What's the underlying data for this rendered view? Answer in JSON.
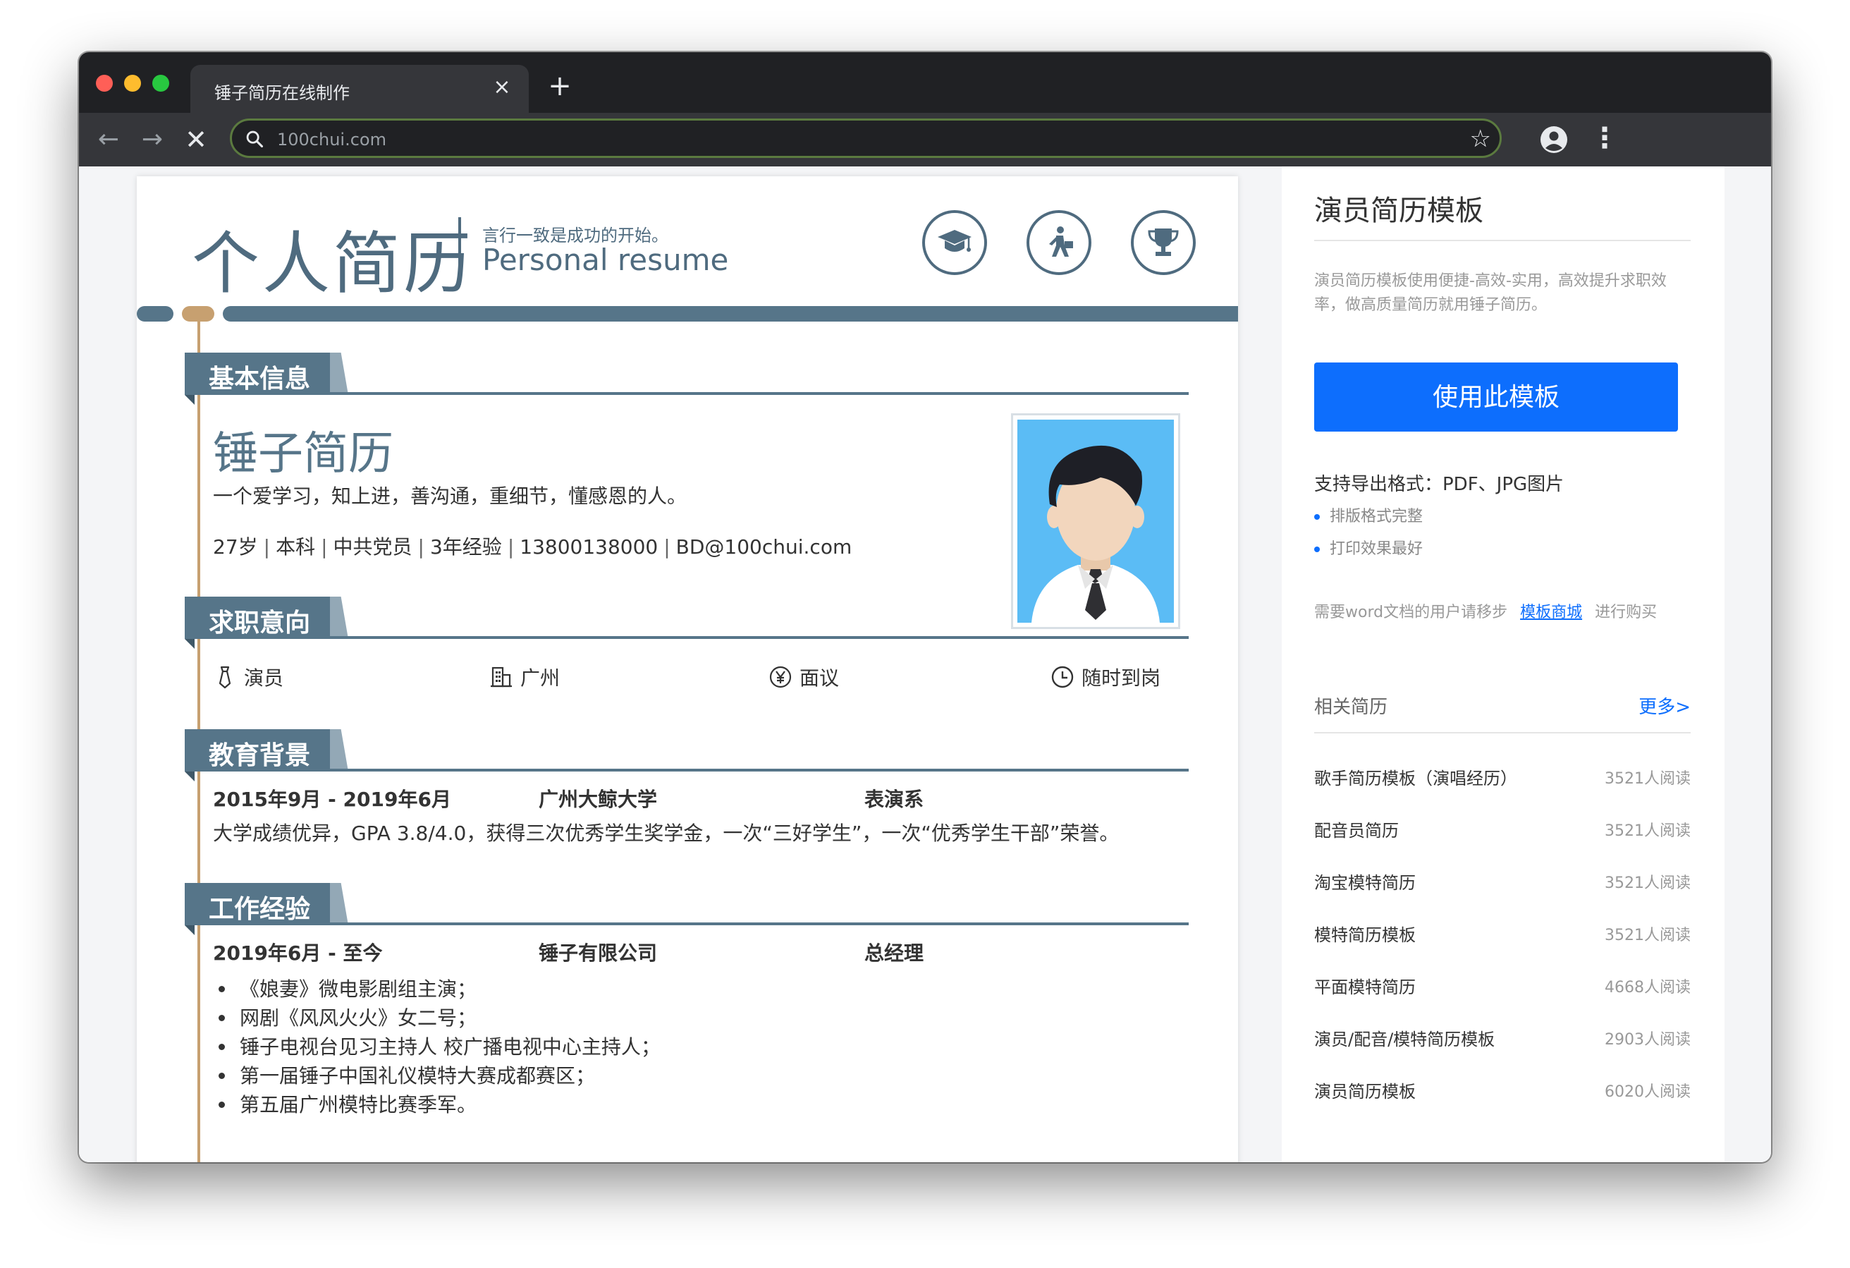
{
  "browser": {
    "tab_title": "锤子简历在线制作",
    "tab_close": "×",
    "new_tab": "+",
    "url": "100chui.com",
    "back": "←",
    "forward": "→",
    "stop": "✕",
    "bookmark": "☆",
    "menu": "⋮"
  },
  "resume": {
    "header": {
      "title": "个人简历",
      "motto": "言行一致是成功的开始。",
      "subtitle_en": "Personal resume",
      "icons": [
        "graduation-cap-icon",
        "walking-person-icon",
        "trophy-icon"
      ]
    },
    "basic": {
      "section_label": "基本信息",
      "name": "锤子简历",
      "intro": "一个爱学习，知上进，善沟通，重细节，懂感恩的人。",
      "contacts": [
        "27岁",
        "本科",
        "中共党员",
        "3年经验",
        "13800138000",
        "BD@100chui.com"
      ],
      "contact_separator": "|"
    },
    "intent": {
      "section_label": "求职意向",
      "items": [
        {
          "icon": "tie-icon",
          "text": "演员"
        },
        {
          "icon": "building-icon",
          "text": "广州"
        },
        {
          "icon": "yen-icon",
          "text": "面议"
        },
        {
          "icon": "clock-icon",
          "text": "随时到岗"
        }
      ]
    },
    "education": {
      "section_label": "教育背景",
      "period": "2015年9月 - 2019年6月",
      "school": "广州大鲸大学",
      "major": "表演系",
      "description": "大学成绩优异，GPA 3.8/4.0，获得三次优秀学生奖学金，一次“三好学生”，一次“优秀学生干部”荣誉。"
    },
    "work": {
      "section_label": "工作经验",
      "period": "2019年6月 - 至今",
      "company": "锤子有限公司",
      "position": "总经理",
      "bullets": [
        "《娘妻》微电影剧组主演；",
        "网剧《风风火火》女二号；",
        "锤子电视台见习主持人 校广播电视中心主持人；",
        "第一届锤子中国礼仪模特大赛成都赛区；",
        "第五届广州模特比赛季军。"
      ]
    }
  },
  "sidebar": {
    "title": "演员简历模板",
    "description": "演员简历模板使用便捷-高效-实用，高效提升求职效率，做高质量简历就用锤子简历。",
    "use_button": "使用此模板",
    "formats": "支持导出格式：PDF、JPG图片",
    "features": [
      "排版格式完整",
      "打印效果最好"
    ],
    "note_prefix": "需要word文档的用户请移步",
    "note_link": "模板商城",
    "note_suffix": "进行购买",
    "related_label": "相关简历",
    "more_link": "更多>",
    "related": [
      {
        "title": "歌手简历模板（演唱经历）",
        "reads": "3521人阅读"
      },
      {
        "title": "配音员简历",
        "reads": "3521人阅读"
      },
      {
        "title": "淘宝模特简历",
        "reads": "3521人阅读"
      },
      {
        "title": "模特简历模板",
        "reads": "3521人阅读"
      },
      {
        "title": "平面模特简历",
        "reads": "4668人阅读"
      },
      {
        "title": "演员/配音/模特简历模板",
        "reads": "2903人阅读"
      },
      {
        "title": "演员简历模板",
        "reads": "6020人阅读"
      }
    ]
  },
  "colors": {
    "primary": "#567589",
    "accent": "#c7a070",
    "button": "#0d6efd",
    "photo_bg": "#5bbcf5"
  }
}
